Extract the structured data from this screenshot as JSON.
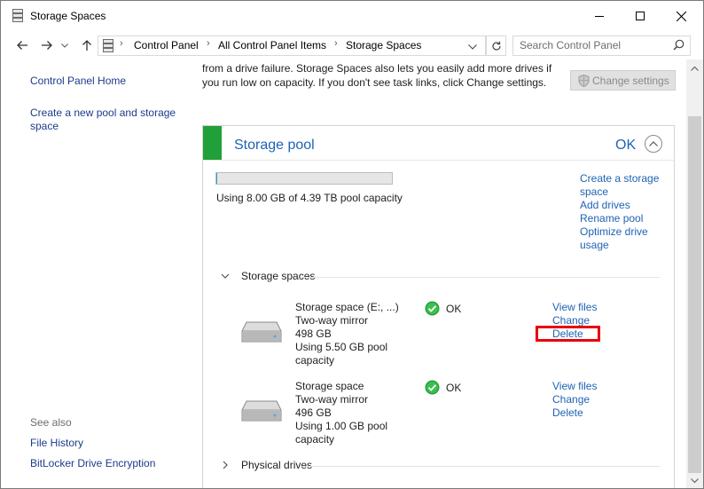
{
  "window": {
    "title": "Storage Spaces",
    "icons": {
      "app": "storage-spaces-icon",
      "minimize": "minimize-icon",
      "maximize": "maximize-icon",
      "close": "close-icon"
    }
  },
  "addressbar": {
    "breadcrumbs": [
      "Control Panel",
      "All Control Panel Items",
      "Storage Spaces"
    ],
    "search_placeholder": "Search Control Panel"
  },
  "sidebar": {
    "links": [
      "Control Panel Home",
      "Create a new pool and storage space"
    ],
    "see_also_heading": "See also",
    "see_also": [
      "File History",
      "BitLocker Drive Encryption"
    ]
  },
  "intro": {
    "line1": "from a drive failure. Storage Spaces also lets you easily add more drives if",
    "line2": "you run low on capacity. If you don't see task links, click Change settings.",
    "change_settings": "Change settings"
  },
  "pool": {
    "title": "Storage pool",
    "status": "OK",
    "usage_fraction": 0.0018,
    "capacity_text": "Using 8.00 GB of 4.39 TB pool capacity",
    "tasks": [
      "Create a storage space",
      "Add drives",
      "Rename pool",
      "Optimize drive usage"
    ],
    "storage_spaces_label": "Storage spaces",
    "physical_drives_label": "Physical drives",
    "spaces": [
      {
        "name": "Storage space (E:, ...)",
        "type": "Two-way mirror",
        "size": "498 GB",
        "usage1": "Using 5.50 GB pool",
        "usage2": "capacity",
        "status": "OK",
        "links": [
          "View files",
          "Change",
          "Delete"
        ]
      },
      {
        "name": "Storage space",
        "type": "Two-way mirror",
        "size": "496 GB",
        "usage1": "Using 1.00 GB pool",
        "usage2": "capacity",
        "status": "OK",
        "links": [
          "View files",
          "Change",
          "Delete"
        ]
      }
    ]
  },
  "colors": {
    "link": "#1e62b5",
    "pool_stripe": "#20a039",
    "ok_green": "#26a13a",
    "highlight": "#e8000b"
  }
}
